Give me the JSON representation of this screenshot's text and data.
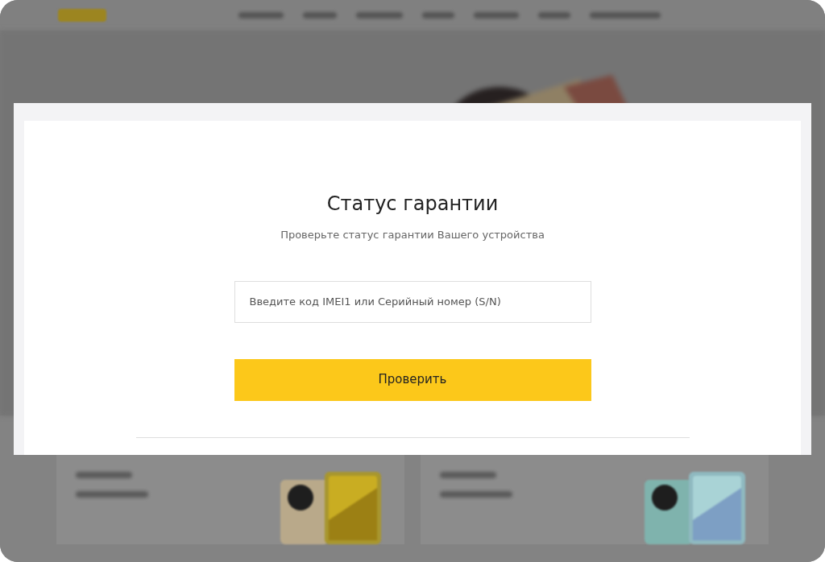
{
  "dialog": {
    "title": "Статус гарантии",
    "subtitle": "Проверьте статус гарантии Вашего устройства",
    "field": {
      "placeholder": "Введите код IMEI1 или Серийный номер (S/N)"
    },
    "button": "Проверить"
  }
}
